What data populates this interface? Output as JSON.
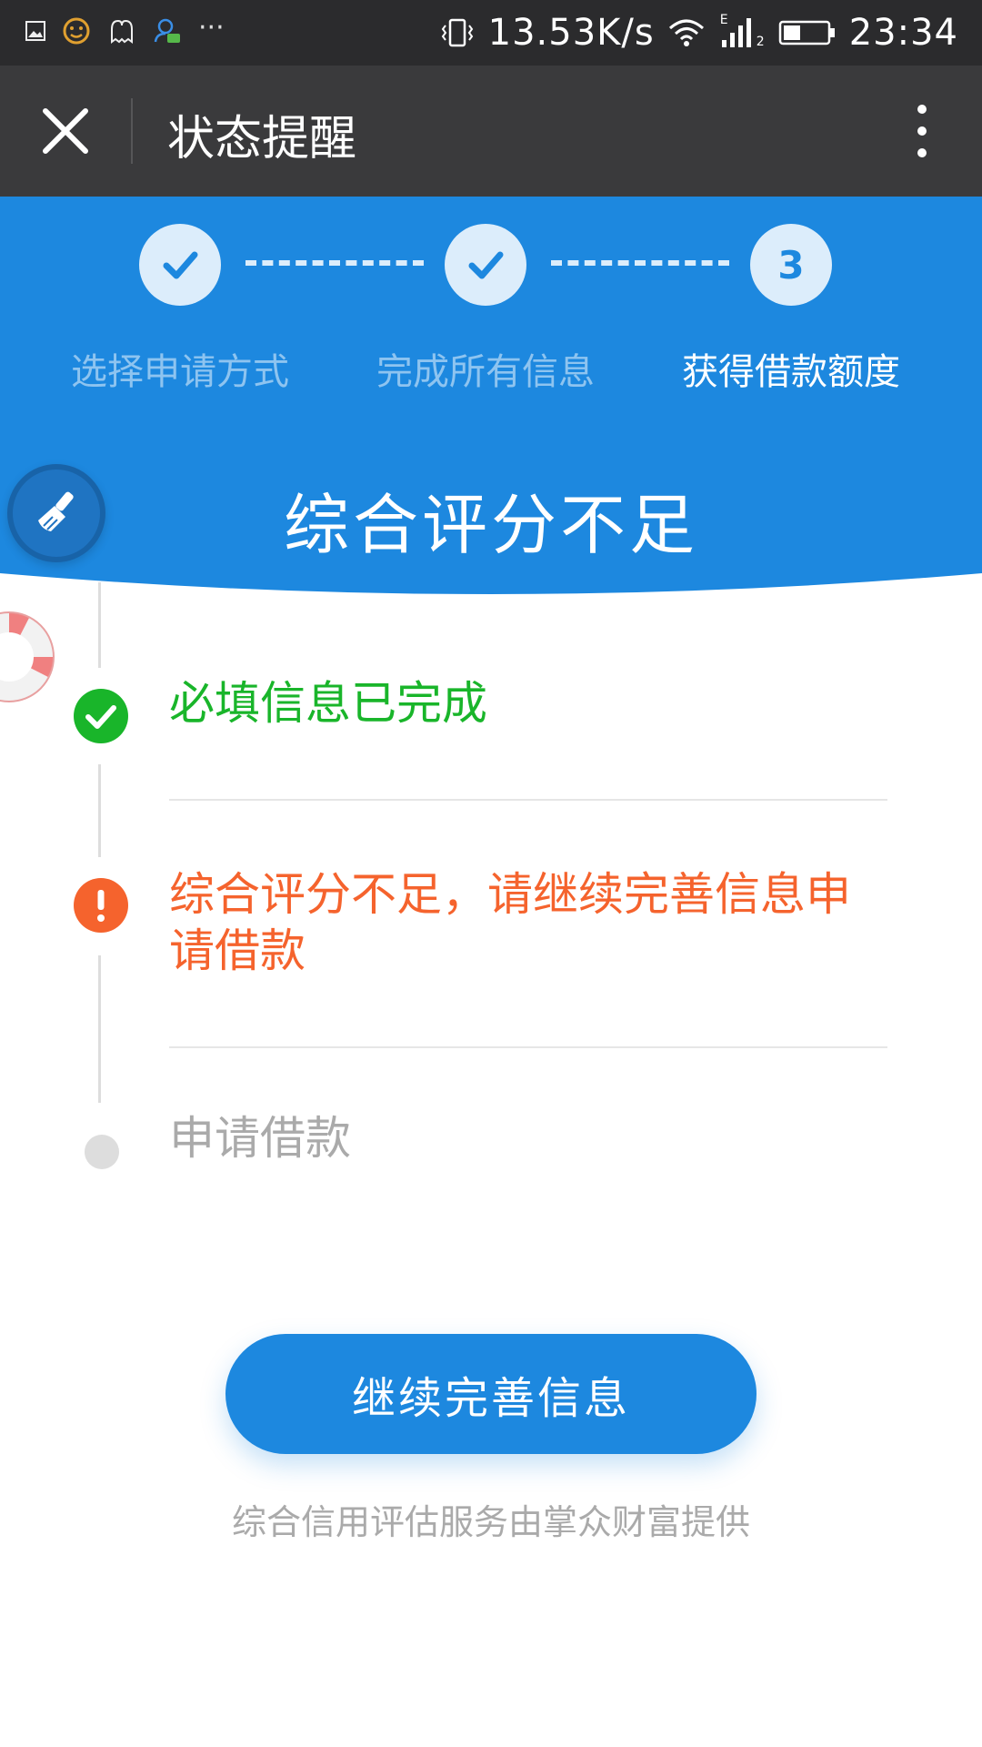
{
  "status_bar": {
    "net_speed": "13.53K/s",
    "time": "23:34",
    "overflow_dots": "···",
    "network_type": "E",
    "sim_slot": "2"
  },
  "app_bar": {
    "title": "状态提醒"
  },
  "steps": {
    "items": [
      {
        "label": "选择申请方式",
        "state": "done"
      },
      {
        "label": "完成所有信息",
        "state": "done"
      },
      {
        "label": "获得借款额度",
        "state": "current",
        "number": "3"
      }
    ]
  },
  "hero": {
    "title": "综合评分不足"
  },
  "timeline": {
    "items": [
      {
        "text": "必填信息已完成",
        "status": "success",
        "color": "#19b52a"
      },
      {
        "text": "综合评分不足，请继续完善信息申请借款",
        "status": "warning",
        "color": "#f5632d"
      },
      {
        "text": "申请借款",
        "status": "pending",
        "color": "#aaaaaa"
      }
    ]
  },
  "action": {
    "button_label": "继续完善信息"
  },
  "footer": {
    "text": "综合信用评估服务由掌众财富提供"
  },
  "colors": {
    "primary": "#1d88df",
    "success": "#19b52a",
    "warning": "#f5632d",
    "pending": "#dddddd"
  },
  "icons": {
    "close": "close-icon",
    "more": "more-vertical-icon",
    "check": "check-icon",
    "broom": "broom-icon",
    "lifebuoy": "lifebuoy-icon",
    "success": "check-circle-icon",
    "warning": "exclamation-circle-icon",
    "pending": "dot-icon"
  }
}
